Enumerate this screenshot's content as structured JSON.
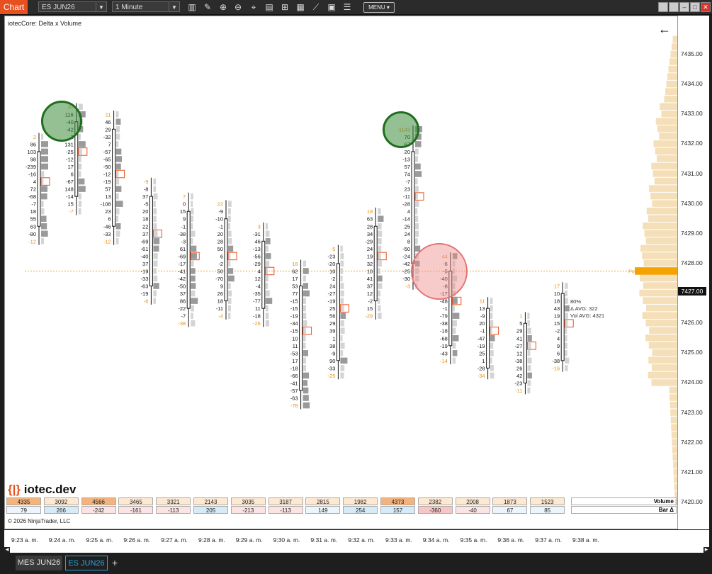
{
  "toolbar": {
    "title": "Chart",
    "instrument": "ES JUN26",
    "interval": "1 Minute",
    "menu_label": "MENU",
    "icons": [
      "bars-icon",
      "draw-icon",
      "zoom-in-icon",
      "zoom-out-icon",
      "crosshair-icon",
      "data-box-icon",
      "strategies-icon",
      "indicators-icon",
      "performance-icon",
      "properties-icon",
      "list-icon"
    ]
  },
  "chart": {
    "indicator_label": "iotecCore: Delta x Volume",
    "copyright": "© 2026 NinjaTrader, LLC",
    "logo_text": "iotec.dev",
    "f_button": "F",
    "current_price": "7427.00",
    "poc_label": "Po",
    "stats": {
      "pct": "80%",
      "delta_avg": "Δ AVG: 322",
      "vol_avg": "Vol AVG: 4321"
    },
    "colors": {
      "negative_box": "#e8501f",
      "green_circle": "#1f6e1f",
      "red_circle": "#e57373",
      "price_line": "#f0a020",
      "volume_profile": "#f5dfb8"
    }
  },
  "price_axis": [
    "7435.00",
    "7434.00",
    "7433.00",
    "7432.00",
    "7431.00",
    "7430.00",
    "7429.00",
    "7428.00",
    "7427.00",
    "7426.00",
    "7425.00",
    "7424.00",
    "7423.00",
    "7422.00",
    "7421.00",
    "7420.00"
  ],
  "time_axis": [
    "9:23 a. m.",
    "9:24 a. m.",
    "9:25 a. m.",
    "9:26 a. m.",
    "9:27 a. m.",
    "9:28 a. m.",
    "9:29 a. m.",
    "9:30 a. m.",
    "9:31 a. m.",
    "9:32 a. m.",
    "9:33 a. m.",
    "9:34 a. m.",
    "9:35 a. m.",
    "9:36 a. m.",
    "9:37 a. m.",
    "9:38 a. m."
  ],
  "bars": [
    {
      "top_price": 7432.25,
      "values": [
        "2",
        "86",
        "103",
        "98",
        "-239",
        "-16",
        "4",
        "72",
        "-68",
        "-7",
        "18",
        "55",
        "63",
        "-80",
        "-12"
      ]
    },
    {
      "top_price": 7433.25,
      "values": [
        "37",
        "116",
        "-40",
        "-42",
        "3",
        "131",
        "-25",
        "-12",
        "17",
        "6",
        "-67",
        "148",
        "-14",
        "15",
        "-7"
      ]
    },
    {
      "top_price": 7433.0,
      "values": [
        "11",
        "46",
        "29",
        "-32",
        "7",
        "-57",
        "-65",
        "-50",
        "-12",
        "-19",
        "57",
        "13",
        "-108",
        "23",
        "6",
        "-46",
        "-33",
        "-12"
      ]
    },
    {
      "top_price": 7430.75,
      "values": [
        "-9",
        "-8",
        "37",
        "-5",
        "20",
        "18",
        "22",
        "37",
        "-69",
        "-61",
        "-40",
        "37",
        "-19",
        "-33",
        "-63",
        "-19",
        "-6"
      ]
    },
    {
      "top_price": 7430.25,
      "values": [
        "7",
        "0",
        "15",
        "9",
        "-1",
        "-38",
        "-3",
        "61",
        "-69",
        "-17",
        "-41",
        "-42",
        "-50",
        "37",
        "86",
        "-22",
        "-7",
        "-38"
      ]
    },
    {
      "top_price": 7430.0,
      "values": [
        "22",
        "-9",
        "-10",
        "-1",
        "20",
        "28",
        "50",
        "6",
        "-2",
        "50",
        "-70",
        "9",
        "26",
        "18",
        "-11",
        "-4"
      ]
    },
    {
      "top_price": 7429.25,
      "values": [
        "3",
        "-31",
        "46",
        "-13",
        "-56",
        "-29",
        "4",
        "12",
        "-4",
        "-35",
        "-77",
        "11",
        "-18",
        "-26"
      ]
    },
    {
      "top_price": 7428.0,
      "values": [
        "18",
        "62",
        "17",
        "53",
        "77",
        "-15",
        "-15",
        "-19",
        "-34",
        "-15",
        "10",
        "11",
        "-53",
        "17",
        "-18",
        "-66",
        "-41",
        "-57",
        "-63",
        "-78"
      ]
    },
    {
      "top_price": 7428.5,
      "values": [
        "-5",
        "-23",
        "-20",
        "10",
        "-2",
        "24",
        "-27",
        "-19",
        "25",
        "56",
        "29",
        "39",
        "1",
        "38",
        "-9",
        "90",
        "-33",
        "-25"
      ]
    },
    {
      "top_price": 7429.75,
      "values": [
        "18",
        "63",
        "28",
        "34",
        "-29",
        "24",
        "19",
        "32",
        "10",
        "41",
        "37",
        "12",
        "-2",
        "15",
        "-29"
      ]
    },
    {
      "top_price": 7432.5,
      "values": [
        "-1143",
        "70",
        "67",
        "20",
        "-13",
        "57",
        "74",
        "-7",
        "23",
        "-11",
        "-28",
        "4",
        "-14",
        "25",
        "24",
        "8",
        "-50",
        "-24",
        "-42",
        "-25",
        "-30",
        "-3"
      ]
    },
    {
      "top_price": 7428.25,
      "values": [
        "44",
        "-6",
        "-5",
        "-40",
        "-8",
        "-17",
        "-48",
        "-1",
        "-79",
        "-38",
        "-18",
        "-68",
        "-19",
        "-43",
        "-14"
      ]
    },
    {
      "top_price": 7426.75,
      "values": [
        "11",
        "13",
        "-9",
        "20",
        "-1",
        "-47",
        "-19",
        "25",
        "1",
        "-28",
        "-34"
      ]
    },
    {
      "top_price": 7426.25,
      "values": [
        "1",
        "5",
        "29",
        "41",
        "-27",
        "12",
        "-38",
        "26",
        "42",
        "-23",
        "-11"
      ]
    },
    {
      "top_price": 7427.25,
      "values": [
        "17",
        "10",
        "18",
        "43",
        "19",
        "15",
        "-2",
        "4",
        "9",
        "6",
        "-38",
        "-16"
      ]
    }
  ],
  "summary": {
    "volume_label": "Volume",
    "delta_label": "Bar Δ",
    "volume": [
      "4335",
      "3092",
      "4566",
      "3465",
      "3321",
      "2143",
      "3035",
      "3187",
      "2815",
      "1982",
      "4373",
      "2382",
      "2008",
      "1873",
      "1523"
    ],
    "delta": [
      "79",
      "266",
      "-242",
      "-161",
      "-113",
      "205",
      "-213",
      "-113",
      "149",
      "254",
      "157",
      "-360",
      "-40",
      "67",
      "85"
    ]
  },
  "tabs": [
    "MES JUN26",
    "ES JUN26"
  ],
  "add_tab": "+"
}
